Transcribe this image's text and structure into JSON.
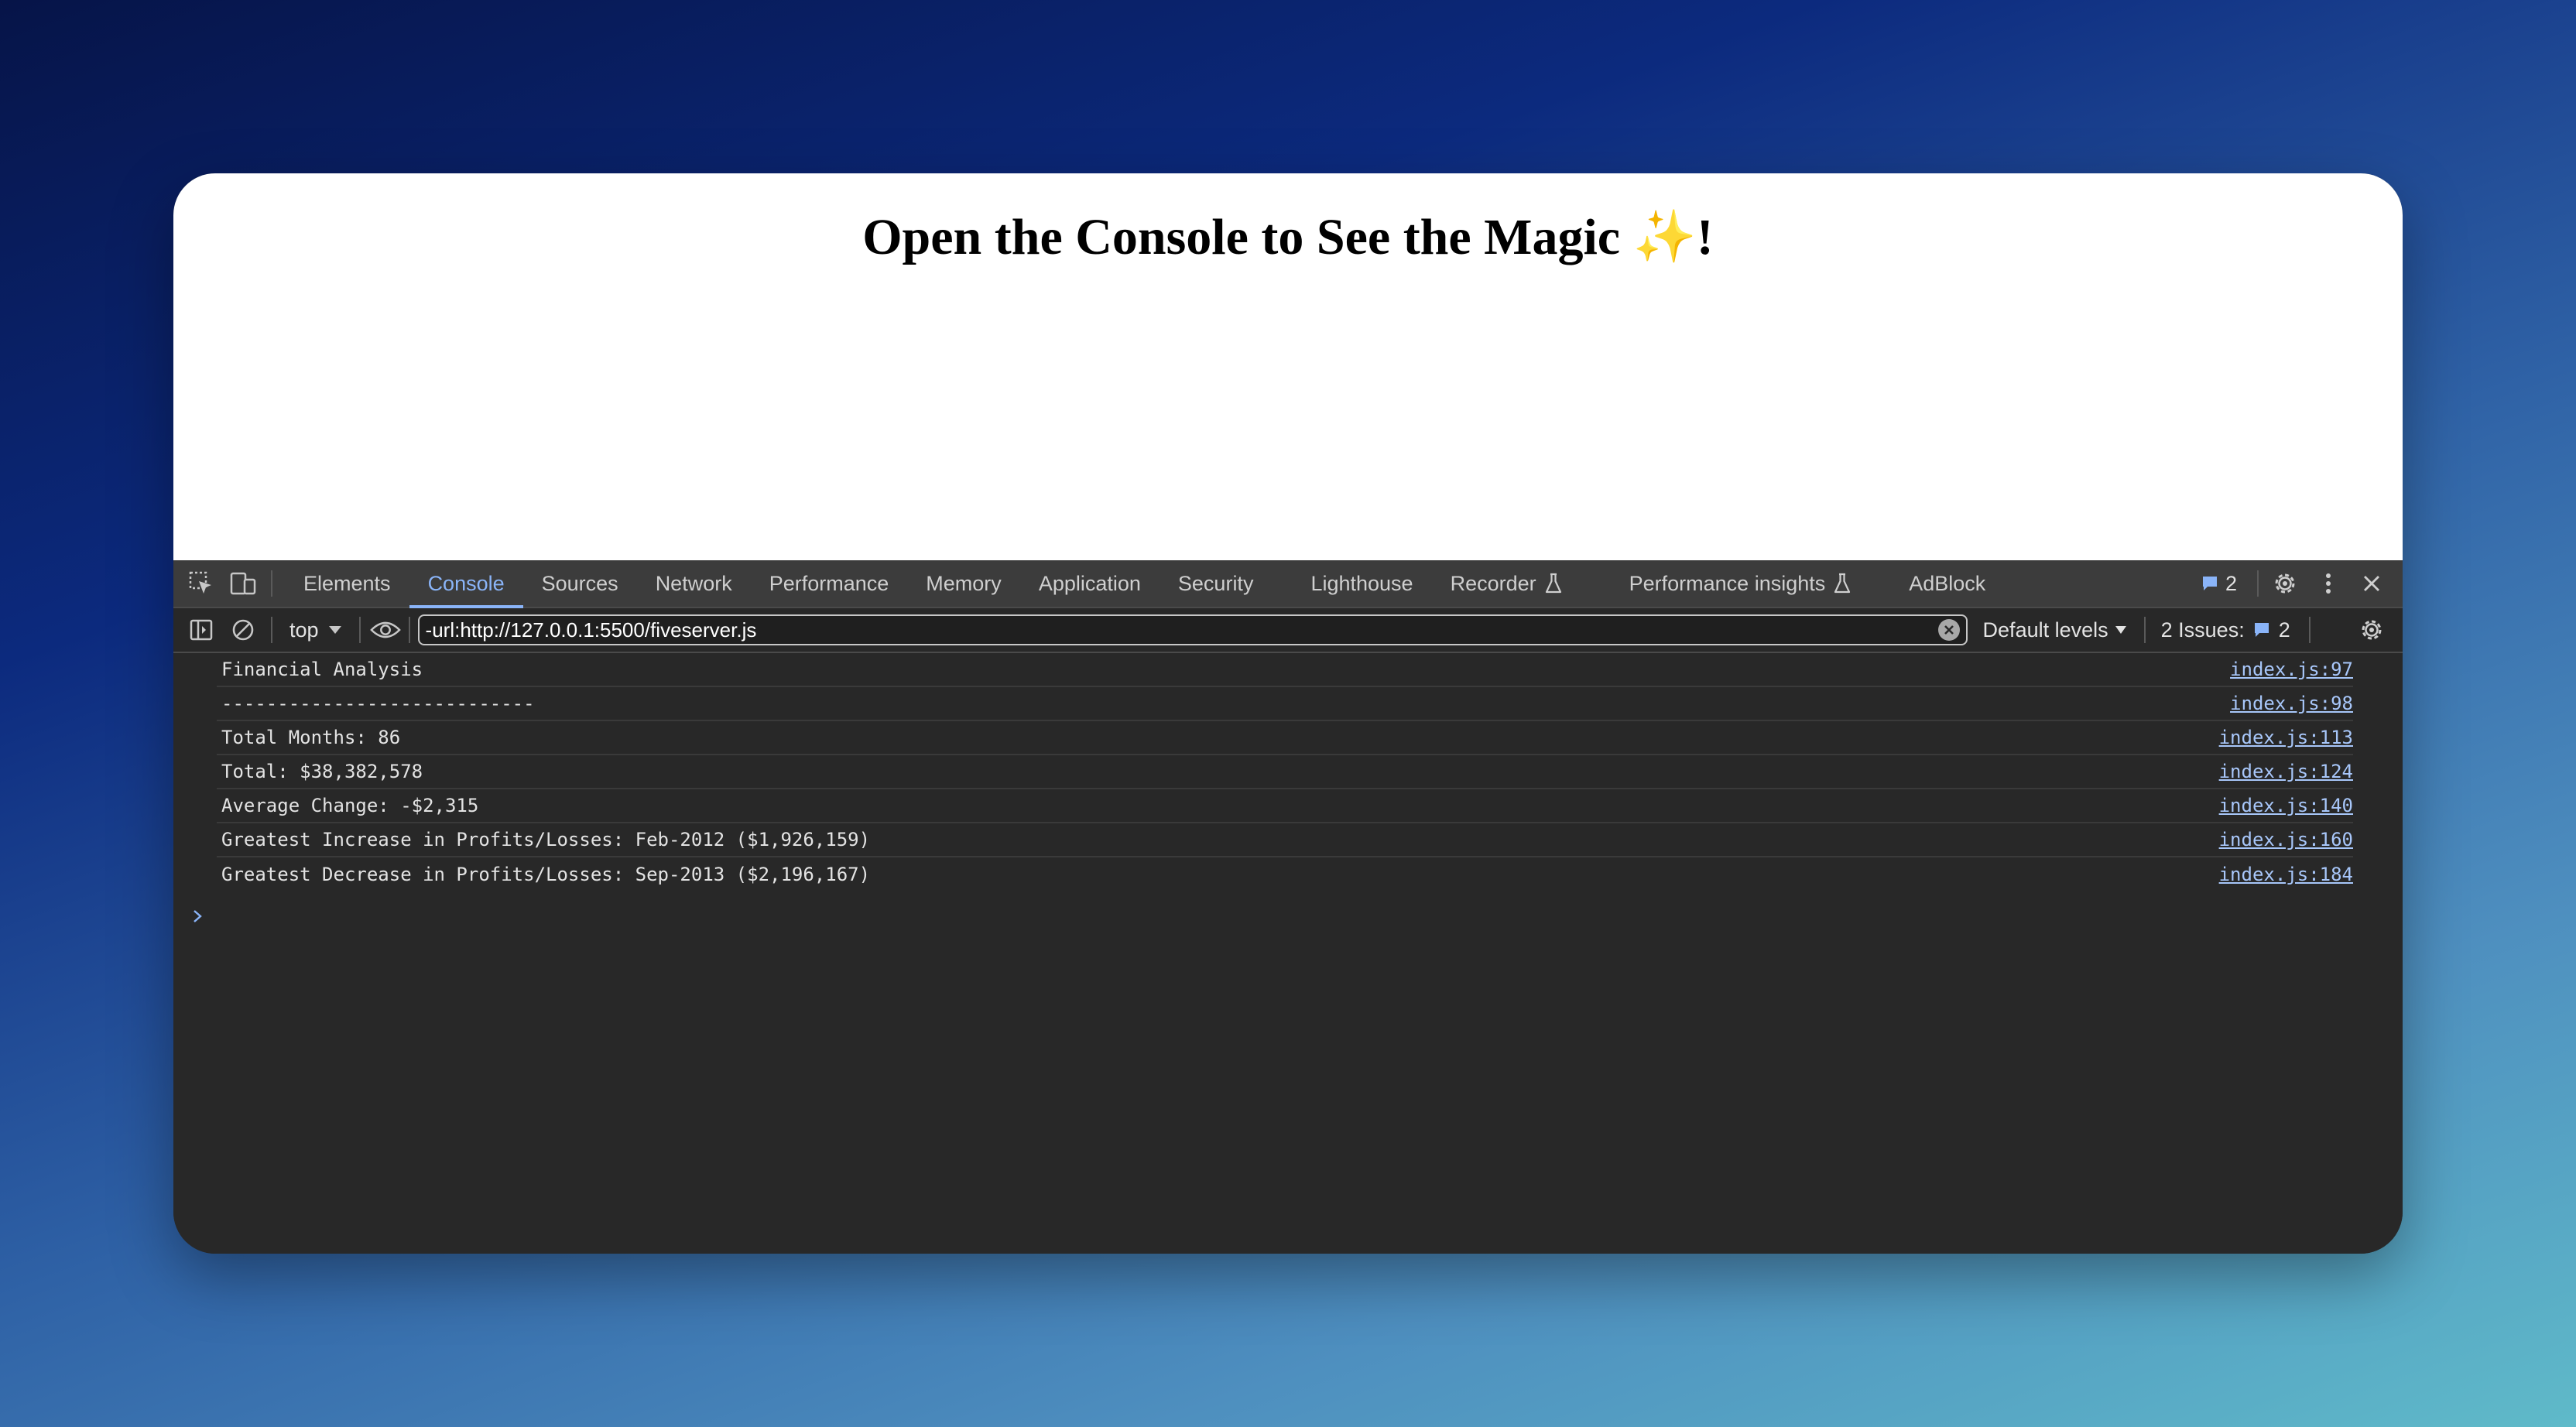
{
  "page": {
    "heading": "Open the Console to See the Magic ",
    "heading_emoji": "✨",
    "heading_suffix": "!"
  },
  "devtools": {
    "tabs": [
      {
        "label": "Elements"
      },
      {
        "label": "Console"
      },
      {
        "label": "Sources"
      },
      {
        "label": "Network"
      },
      {
        "label": "Performance"
      },
      {
        "label": "Memory"
      },
      {
        "label": "Application"
      },
      {
        "label": "Security"
      },
      {
        "label": "Lighthouse"
      },
      {
        "label": "Recorder"
      },
      {
        "label": "Performance insights"
      },
      {
        "label": "AdBlock"
      }
    ],
    "active_tab": "Console",
    "messages_badge": "2",
    "toolbar": {
      "context": "top",
      "filter_value": "-url:http://127.0.0.1:5500/fiveserver.js",
      "levels": "Default levels",
      "issues_label": "2 Issues:",
      "issues_count": "2"
    },
    "logs": [
      {
        "message": "Financial Analysis",
        "source": "index.js:97"
      },
      {
        "message": "----------------------------",
        "source": "index.js:98"
      },
      {
        "message": "Total Months: 86",
        "source": "index.js:113"
      },
      {
        "message": "Total: $38,382,578",
        "source": "index.js:124"
      },
      {
        "message": "Average Change: -$2,315",
        "source": "index.js:140"
      },
      {
        "message": "Greatest Increase in Profits/Losses: Feb-2012 ($1,926,159)",
        "source": "index.js:160"
      },
      {
        "message": "Greatest Decrease in Profits/Losses: Sep-2013 ($2,196,167)",
        "source": "index.js:184"
      }
    ],
    "prompt_symbol": "›",
    "colors": {
      "accent": "#8ab4f8",
      "link": "#a8c7fa",
      "panel_bg": "#282828",
      "tabbar_bg": "#3c3c3c"
    }
  }
}
